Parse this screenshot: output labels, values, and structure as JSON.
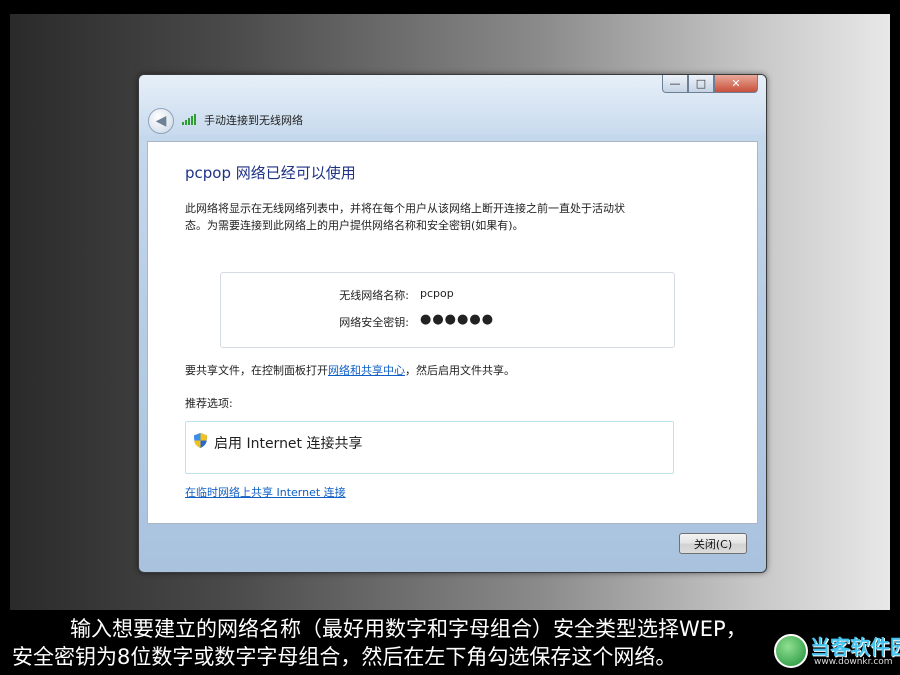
{
  "window": {
    "title": "手动连接到无线网络",
    "caption_buttons": {
      "minimize": "—",
      "maximize": "□",
      "close": "✕"
    }
  },
  "content": {
    "headline": "pcpop 网络已经可以使用",
    "description": "此网络将显示在无线网络列表中，并将在每个用户从该网络上断开连接之前一直处于活动状态。为需要连接到此网络上的用户提供网络名称和安全密钥(如果有)。",
    "network": {
      "name_label": "无线网络名称:",
      "name_value": "pcpop",
      "key_label": "网络安全密钥:",
      "key_value": "●●●●●●"
    },
    "share": {
      "prefix": "要共享文件，在控制面板打开",
      "link": "网络和共享中心",
      "suffix": "，然后启用文件共享。"
    },
    "recommended_label": "推荐选项:",
    "option_ics": "启用 Internet 连接共享",
    "adhoc_link": "在临时网络上共享 Internet 连接"
  },
  "footer": {
    "close_button": "关闭(C)"
  },
  "caption": {
    "line1": "输入想要建立的网络名称（最好用数字和字母组合）安全类型选择WEP，",
    "line2": "安全密钥为8位数字或数字字母组合，然后在左下角勾选保存这个网络。"
  },
  "watermark": {
    "main": "当客软件园",
    "sub": "www.downkr.com"
  },
  "icons": {
    "back": "back-arrow-icon",
    "signal": "wireless-signal-icon",
    "shield": "uac-shield-icon",
    "logo": "downkr-logo-icon"
  },
  "colors": {
    "headline": "#1e3287",
    "link": "#0f5fc5",
    "signal": "#2f9d2f"
  }
}
